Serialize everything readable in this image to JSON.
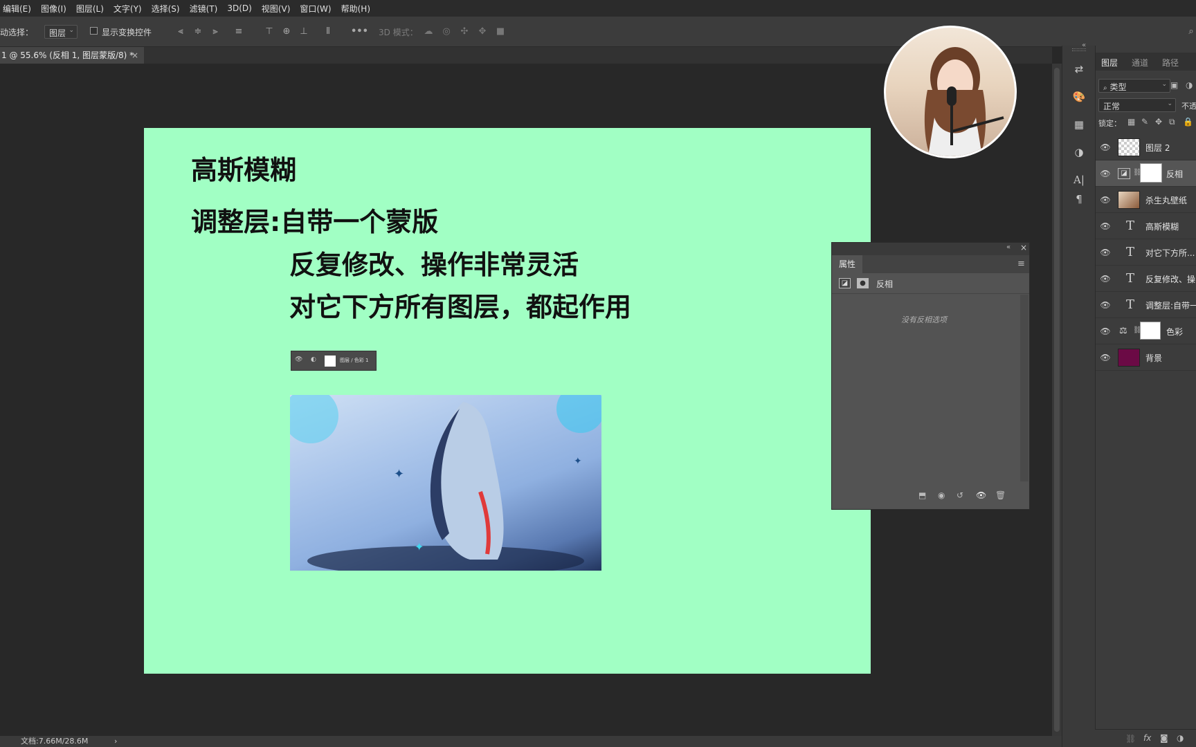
{
  "menu": [
    "编辑(E)",
    "图像(I)",
    "图层(L)",
    "文字(Y)",
    "选择(S)",
    "滤镜(T)",
    "3D(D)",
    "视图(V)",
    "窗口(W)",
    "帮助(H)"
  ],
  "options": {
    "auto_select_label": "动选择：",
    "auto_select_value": "图层",
    "show_transform": "显示变换控件",
    "mode_3d": "3D 模式："
  },
  "doc_tab": {
    "title": "1 @ 55.6% (反相 1, 图层蒙版/8) *",
    "close": "×"
  },
  "document": {
    "title": "高斯模糊",
    "line1": "调整层:自带一个蒙版",
    "line2": "反复修改、操作非常灵活",
    "line3": "对它下方所有图层，都起作用",
    "mini_layer_label": "图层 / 色彩 1"
  },
  "properties": {
    "title": "属性",
    "adjustment_name": "反相",
    "empty_note": "没有反相选项"
  },
  "layers_panel": {
    "tabs": [
      "图层",
      "通道",
      "路径"
    ],
    "filter_kind": "类型",
    "blend_mode": "正常",
    "opacity_label": "不透",
    "lock_label": "锁定：",
    "layers": [
      {
        "name": "图层 2",
        "kind": "pixel",
        "active": false
      },
      {
        "name": "反相",
        "kind": "adjust-invert",
        "active": true
      },
      {
        "name": "杀生丸壁纸",
        "kind": "image",
        "active": false
      },
      {
        "name": "高斯模糊",
        "kind": "text",
        "active": false
      },
      {
        "name": "对它下方所...",
        "kind": "text",
        "active": false
      },
      {
        "name": "反复修改、操",
        "kind": "text",
        "active": false
      },
      {
        "name": "调整层:自带一",
        "kind": "text",
        "active": false
      },
      {
        "name": "色彩",
        "kind": "adjust-balance",
        "active": false
      },
      {
        "name": "背景",
        "kind": "fill",
        "active": false
      }
    ]
  },
  "status": {
    "doc_size": "文档:7.66M/28.6M",
    "arrow": "›"
  },
  "colors": {
    "canvas_bg": "#a1ffc4",
    "background_layer": "#6b0a45",
    "workspace": "#282828",
    "panel": "#3c3c3c"
  }
}
